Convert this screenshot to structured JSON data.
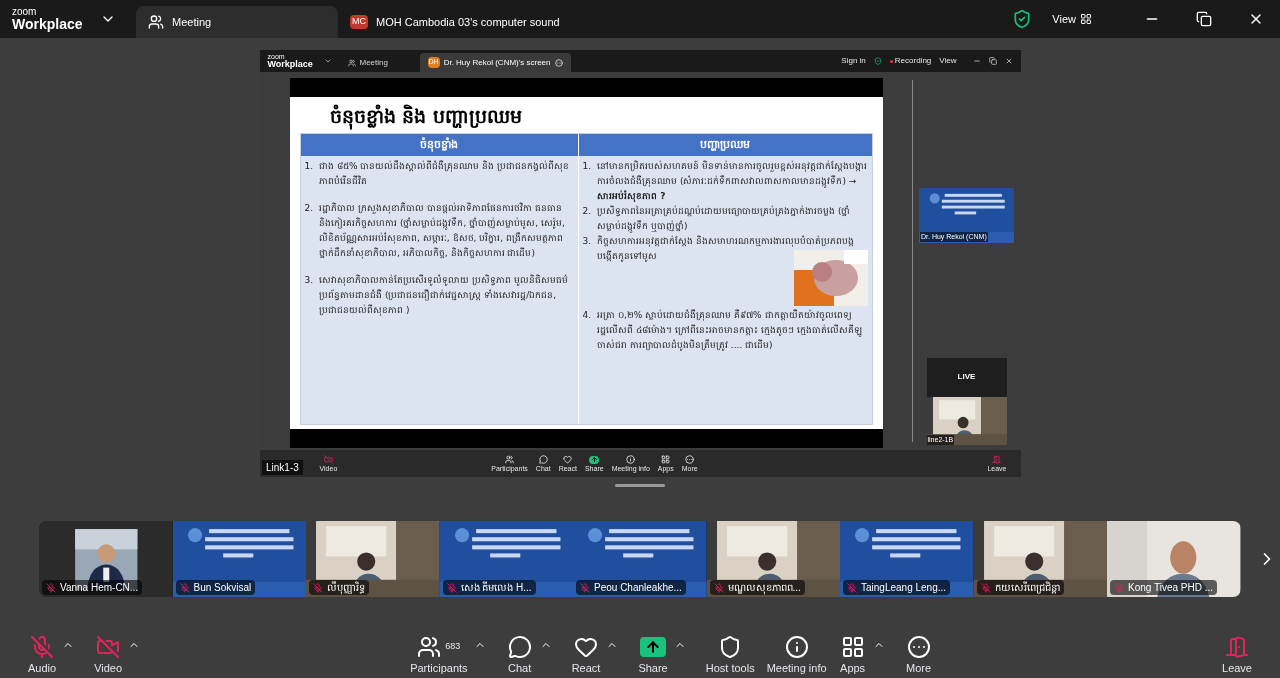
{
  "top_bar": {
    "logo_top": "zoom",
    "logo_bottom": "Workplace",
    "tabs": [
      {
        "label": "Meeting",
        "selected": true,
        "kind": "meeting"
      },
      {
        "label": "MOH Cambodia 03's computer sound",
        "selected": false,
        "kind": "audio",
        "badge": "MC"
      }
    ],
    "view_button": "View"
  },
  "shared_window": {
    "logo_top": "zoom",
    "logo_bottom": "Workplace",
    "tabs": [
      {
        "label": "Meeting",
        "selected": false,
        "kind": "meeting"
      },
      {
        "label": "Dr. Huy Rekol (CNM)'s screen",
        "selected": true,
        "kind": "screen",
        "badge": "DH"
      }
    ],
    "sign_in": "Sign in",
    "recording": "Recording",
    "view": "View",
    "slide": {
      "title": "ចំនុចខ្លាំង និង បញ្ហាប្រឈម",
      "columns": [
        {
          "header": "ចំនុចខ្លាំង",
          "items": [
            {
              "number": "1.",
              "text": "ជាង ៨៥% បានយល់ដឹងស្គាល់ពីជំងឺគ្រុនឈាម និង ប្រជាជនកង្វល់ពីសុខភាពបំរើនជីវិត"
            },
            {
              "number": "2.",
              "text": "រដ្ឋាភិបាល ក្រសួងសុខាភិបាល បានផ្តល់អាទិភាពផែនការថវិកា ធនធាន និងកៀរគរកិច្ចសហការ (ថ្នាំសម្លាប់ដង្កូវទឹក, ថ្នាំបាញ់សម្លាប់មូស, សេរ៉ូម, លិខិតប័ណ្ណសារអប់រំសុខភាព, សម្ភារៈ, ឱសថ, បរិក្ខារ, ពង្រឹកសមត្ថភាពថ្នាក់ដឹកនាំសុខាភិបាល, អភិបាលកិច្ច, និងកិច្ចសហការ ជាដើម)"
            },
            {
              "number": "3.",
              "text": "សេវាសុខាភិបាលកាន់តែប្រសើរទូលំទូលាយ ប្រសិទ្ធភាព មូលនិធិសមធម៌ ប្រព័ន្ធតាមដានជំងឺ (ប្រជាជនជឿជាក់វេជ្ជសាស្ត្រ ទាំងសេវារដ្ឋ/ឯកជន, ប្រជាជនយល់ពីសុខភាព )"
            }
          ]
        },
        {
          "header": "បញ្ហាប្រឈម",
          "items": [
            {
              "number": "1.",
              "text": "នៅមានកម្រិតរបស់សហគមន៍ មិនទាន់មានការចូលរួមខ្ពស់អនុវត្តជាក់ស្តែងបង្ការការចំលងជំងឺគ្រុនឈាម (សំភារៈដក់ទឹកពាសវាលពាសកាលមានដង្កូវទឹក) → **សារអប់រំសុខភាព ?**"
            },
            {
              "number": "2.",
              "text": "ប្រសិទ្ធភាពនៃអត្រាគ្រប់ដណ្តប់ដោយមធ្យោបាយគ្រប់គ្រងភ្នាក់ងារចម្លង (ថ្នាំសម្លាប់ដង្កូវទឹក ឬបាញ់ថ្នាំ)"
            },
            {
              "number": "3.",
              "text": "កិច្ចសហការអនុវត្តជាក់ស្តែង និងសមាហរណកម្មការងារលុបបំបាត់ប្រភពបង្កបង្កើតកូនទៅមូស"
            },
            {
              "number": "4.",
              "text": "អត្រា ០,២% ស្លាប់ដោយជំងឺគ្រុនឈាម គឺ៩៧% ជាកត្តាយឺតយ៉ាវចូលពេទ្យរដ្ឋលើសពី ៤៨ម៉ោង។ ក្រៅពីនេះអាចមានកត្តា៖ ក្មេងតូចៗ ក្មេងធាត់លើសគីឡូ ចាស់ជរា ការព្យាបាលដំបូងមិនត្រឹមត្រូវ .... ជាដើម)"
            }
          ]
        }
      ]
    },
    "video_tile": {
      "name": "Dr. Huy Rekol (CNM)"
    },
    "live_tile": {
      "badge": "LIVE",
      "name": "line2-1B"
    },
    "toolbar": [
      {
        "label": "Video",
        "kind": "video"
      },
      {
        "label": "Participants",
        "kind": "participants"
      },
      {
        "label": "Chat",
        "kind": "chat"
      },
      {
        "label": "React",
        "kind": "react"
      },
      {
        "label": "Share",
        "kind": "share"
      },
      {
        "label": "Meeting info",
        "kind": "info"
      },
      {
        "label": "Apps",
        "kind": "apps"
      },
      {
        "label": "More",
        "kind": "more"
      },
      {
        "label": "Leave",
        "kind": "leave"
      }
    ]
  },
  "share_label": "Link1-3",
  "gallery": [
    {
      "name": "Vanna Hem-CN...",
      "muted": true,
      "kind": "person"
    },
    {
      "name": "Bun Sokvisal",
      "muted": true,
      "kind": "banner"
    },
    {
      "name": "លឹបុញ្ញារិទ្ធ",
      "muted": true,
      "kind": "room"
    },
    {
      "name": "សេង គីមលេង H...",
      "muted": true,
      "kind": "banner"
    },
    {
      "name": "Peou Chanleakhe...",
      "muted": true,
      "kind": "banner"
    },
    {
      "name": "មណ្ឌលសុខភាពព...",
      "muted": true,
      "kind": "room"
    },
    {
      "name": "TaingLeang Leng...",
      "muted": true,
      "kind": "banner"
    },
    {
      "name": "កយសេរីពេជ្រជិន្ដា",
      "muted": true,
      "kind": "room"
    },
    {
      "name": "Kong Tivea  PHD ...",
      "muted": true,
      "kind": "blur"
    }
  ],
  "toolbar": [
    {
      "label": "Audio",
      "kind": "audio",
      "off": true
    },
    {
      "label": "Video",
      "kind": "video",
      "off": true
    },
    {
      "label": "Participants",
      "kind": "participants",
      "count": "683"
    },
    {
      "label": "Chat",
      "kind": "chat"
    },
    {
      "label": "React",
      "kind": "react"
    },
    {
      "label": "Share",
      "kind": "share"
    },
    {
      "label": "Host tools",
      "kind": "host"
    },
    {
      "label": "Meeting info",
      "kind": "info"
    },
    {
      "label": "Apps",
      "kind": "apps"
    },
    {
      "label": "More",
      "kind": "more"
    },
    {
      "label": "Leave",
      "kind": "leave"
    }
  ]
}
